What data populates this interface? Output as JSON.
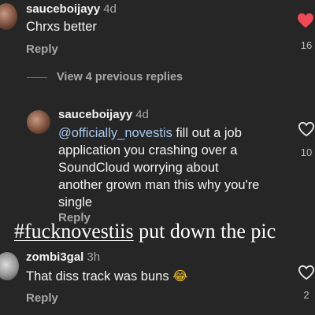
{
  "comment1": {
    "username": "sauceboijayy",
    "time": "4d",
    "text": "Chrxs better",
    "reply_label": "Reply",
    "like_count": "16",
    "liked": true
  },
  "view_replies": "View 4 previous replies",
  "reply1": {
    "username": "sauceboijayy",
    "time": "4d",
    "mention": "@officially_novestis",
    "text_line1_rest": " fill out a job",
    "text_line2": "application you crashing over a",
    "text_line3": "SoundCloud worrying about",
    "text_line4": "another grown man this why you're",
    "text_line5": "single",
    "reply_label": "Reply",
    "like_count": "10",
    "liked": false
  },
  "overlay": {
    "hashtag": "#fucknovestiis",
    "rest": " put down the pic"
  },
  "comment2": {
    "username": "zombi3gal",
    "time": "3h",
    "text": "That diss track was buns",
    "emoji": "😂",
    "reply_label": "Reply",
    "like_count": "2",
    "liked": false
  },
  "colors": {
    "background": "#262626",
    "liked_heart": "#ed4956",
    "mention": "#a9c7ee",
    "muted": "#a8a8a8"
  },
  "icons": {
    "like_filled": "heart-filled-icon",
    "like_outline": "heart-outline-icon"
  }
}
